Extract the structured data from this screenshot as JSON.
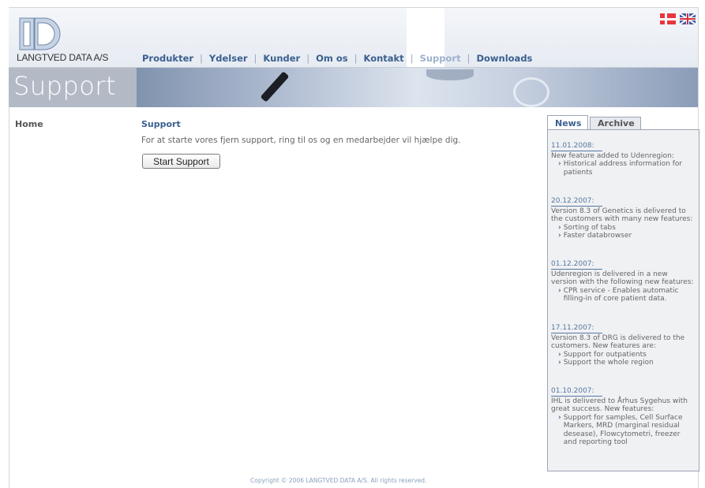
{
  "company": "LANGTVED DATA A/S",
  "nav": [
    "Produkter",
    "Ydelser",
    "Kunder",
    "Om os",
    "Kontakt",
    "Support",
    "Downloads"
  ],
  "nav_active_index": 5,
  "banner_title": "Support",
  "sidebar": {
    "home": "Home"
  },
  "main": {
    "title": "Support",
    "text": "For at starte vores fjern support, ring til os og en medarbejder vil hjælpe dig.",
    "button": "Start Support"
  },
  "news": {
    "tabs": [
      "News",
      "Archive"
    ],
    "items": [
      {
        "date": "11.01.2008:",
        "text": "New feature added to Udenregion:",
        "bullets": [
          "Historical address information for patients"
        ]
      },
      {
        "date": "20.12.2007:",
        "text": "Version 8.3 of Genetics is delivered to the customers with many new features:",
        "bullets": [
          "Sorting of tabs",
          "Faster databrowser"
        ]
      },
      {
        "date": "01.12.2007:",
        "text": "Udenregion is delivered in a new version with the following new features:",
        "bullets": [
          "CPR service - Enables automatic filling-in of core patient data."
        ]
      },
      {
        "date": "17.11.2007:",
        "text": "Version 8.3 of DRG is delivered to the customers. New features are:",
        "bullets": [
          "Support for outpatients",
          "Support the whole region"
        ]
      },
      {
        "date": "01.10.2007:",
        "text": "IHL is delivered to Århus Sygehus with great success. New features:",
        "bullets": [
          "Support for samples, Cell Surface Markers, MRD (marginal residual desease), Flowcytometri, freezer and reporting tool"
        ]
      }
    ]
  },
  "copyright": "Copyright © 2006 LANGTVED DATA A/S. All rights reserved.",
  "colors": {
    "accent": "#3a5f8f",
    "active_nav": "#9db2cc",
    "banner": "#b3bac6"
  }
}
